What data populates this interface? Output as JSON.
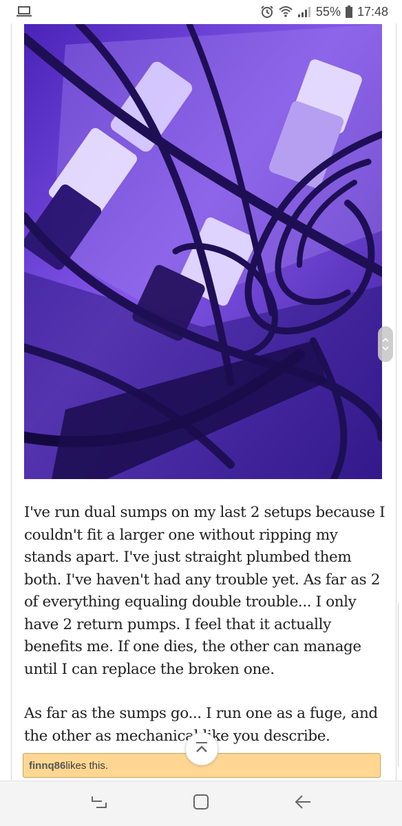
{
  "status_bar": {
    "battery_percent": "55%",
    "time": "17:48",
    "icons": [
      "laptop-icon",
      "alarm-icon",
      "wifi-icon",
      "signal-icon",
      "battery-icon"
    ]
  },
  "post": {
    "photo_icon": "aquarium-sump-plumbing-photo",
    "paragraphs": [
      "I've run dual sumps on my last 2 setups because I couldn't fit a larger one without ripping my stands apart. I've just straight plumbed them both. I've haven't had any trouble yet. As far as 2 of everything equaling double trouble... I only have 2 return pumps. I feel that it actually benefits me. If one dies, the other can manage until I can replace the broken one.",
      "As far as the sumps go... I run one as a fuge, and the other as mechanical like you describe."
    ]
  },
  "likes": {
    "user": "finnq86",
    "suffix": " likes this."
  },
  "nav_bar": {
    "icons": [
      "recents-icon",
      "home-icon",
      "back-icon"
    ]
  },
  "colors": {
    "likes_background": "#ffd793",
    "photo_tint": "#6a3fd6"
  }
}
